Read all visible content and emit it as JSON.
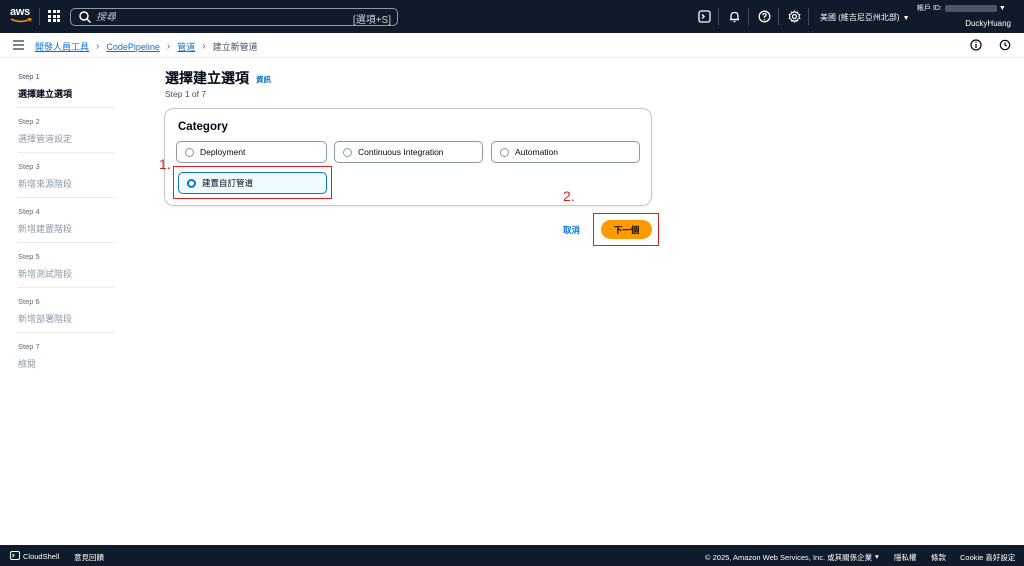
{
  "topnav": {
    "logo_text": "aws",
    "search_placeholder": "搜尋",
    "search_shortcut": "[選項+S]",
    "region": "美國 (維吉尼亞州北部)",
    "account_label": "帳戶 ID:",
    "user_name": "DuckyHuang"
  },
  "breadcrumb": {
    "items": [
      "開發人員工具",
      "CodePipeline",
      "管道"
    ],
    "current": "建立新管道"
  },
  "steps": [
    {
      "label": "Step 1",
      "title": "選擇建立選項",
      "active": true
    },
    {
      "label": "Step 2",
      "title": "選擇管道設定",
      "active": false
    },
    {
      "label": "Step 3",
      "title": "新增來源階段",
      "active": false
    },
    {
      "label": "Step 4",
      "title": "新增建置階段",
      "active": false
    },
    {
      "label": "Step 5",
      "title": "新增測試階段",
      "active": false
    },
    {
      "label": "Step 6",
      "title": "新增部署階段",
      "active": false
    },
    {
      "label": "Step 7",
      "title": "檢閱",
      "active": false
    }
  ],
  "main": {
    "title": "選擇建立選項",
    "info_link": "資訊",
    "step_of": "Step 1 of 7",
    "category_title": "Category",
    "options": [
      {
        "label": "Deployment",
        "selected": false
      },
      {
        "label": "Continuous Integration",
        "selected": false
      },
      {
        "label": "Automation",
        "selected": false
      },
      {
        "label": "建置自訂管道",
        "selected": true
      }
    ],
    "cancel_label": "取消",
    "next_label": "下一個"
  },
  "annotations": {
    "one": "1.",
    "two": "2."
  },
  "footer": {
    "cloudshell": "CloudShell",
    "feedback": "意見回饋",
    "copyright": "© 2025, Amazon Web Services, Inc. 或其關係企業",
    "privacy": "隱私權",
    "terms": "條款",
    "cookie": "Cookie 喜好設定"
  },
  "colors": {
    "nav_bg": "#0f1b2a",
    "link": "#0972d3",
    "primary_button": "#ff9900",
    "annotation_red": "#e02020"
  }
}
